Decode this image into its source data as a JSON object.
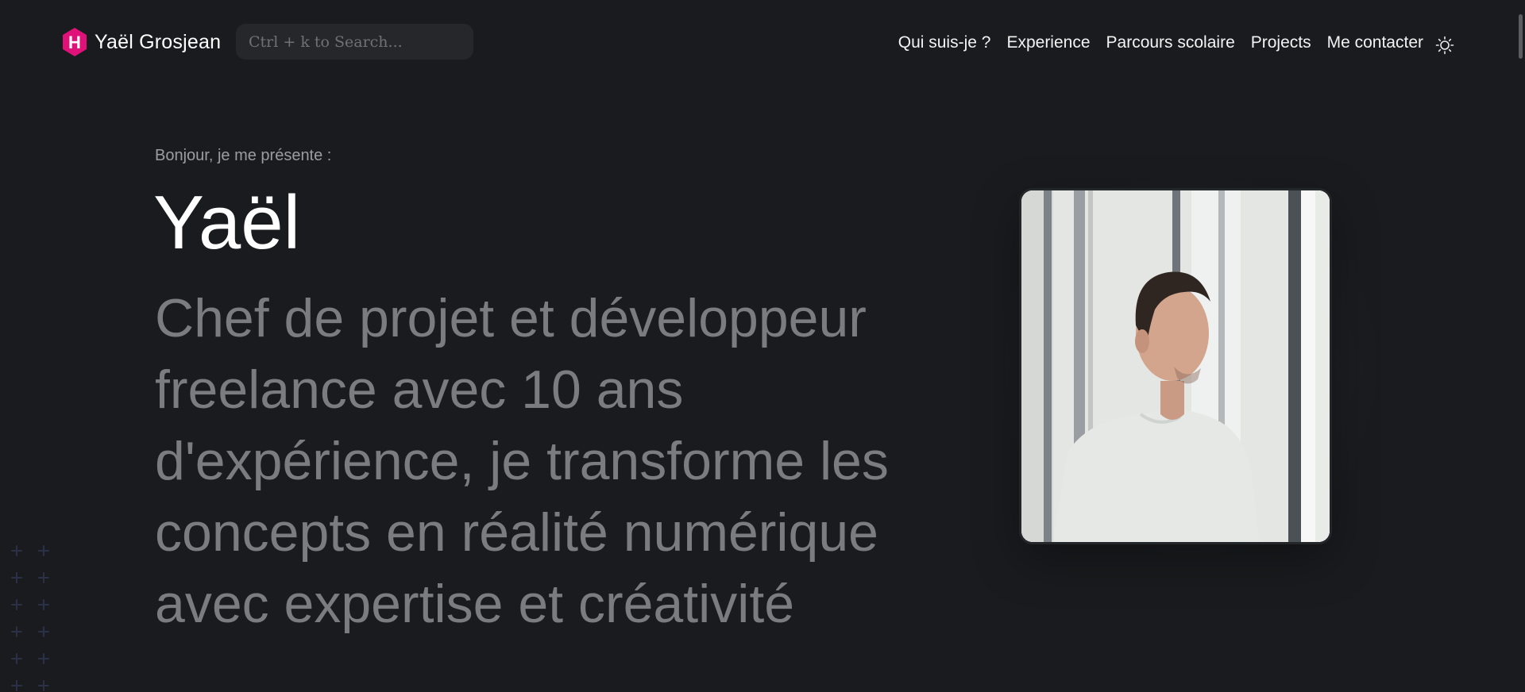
{
  "header": {
    "brand": {
      "logo_letter": "H",
      "name": "Yaël Grosjean",
      "logo_color": "#e0127a"
    },
    "search": {
      "placeholder": "Ctrl + k to Search..."
    },
    "nav": [
      {
        "label": "Qui suis-je ?"
      },
      {
        "label": "Experience"
      },
      {
        "label": "Parcours scolaire"
      },
      {
        "label": "Projects"
      },
      {
        "label": "Me contacter"
      }
    ],
    "theme_toggle_icon": "sun-icon"
  },
  "hero": {
    "greeting": "Bonjour, je me présente :",
    "name": "Yaël",
    "tagline": "Chef de projet et développeur freelance avec 10 ans d'expérience, je transforme les concepts en réalité numérique avec expertise et créativité"
  },
  "colors": {
    "background": "#1a1b1e",
    "accent": "#e0127a",
    "muted_text": "#7b7c80"
  }
}
